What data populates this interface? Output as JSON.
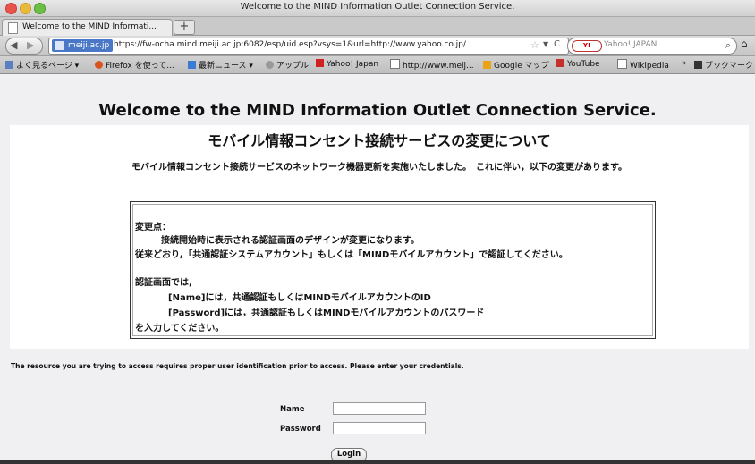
{
  "window": {
    "title": "Welcome to the MIND Information Outlet Connection Service."
  },
  "tab": {
    "label": "Welcome to the MIND Informati...",
    "new_tab": "+"
  },
  "navbar": {
    "site_identity": "meiji.ac.jp",
    "url": "https://fw-ocha.mind.meiji.ac.jp:6082/esp/uid.esp?vsys=1&url=http://www.yahoo.co.jp/",
    "search_engine": "Y!",
    "search_placeholder": "Yahoo! JAPAN"
  },
  "bookmarks": [
    {
      "label": "よく見るページ ▾",
      "icon": "bookmarks-icon"
    },
    {
      "label": "Firefox を使って...",
      "icon": "firefox-icon"
    },
    {
      "label": "最新ニュース ▾",
      "icon": "rss-icon"
    },
    {
      "label": "アップル",
      "icon": "apple-icon"
    },
    {
      "label": "Yahoo! Japan",
      "icon": "yahoo-icon"
    },
    {
      "label": "http://www.meij...",
      "icon": "page-icon"
    },
    {
      "label": "Google マップ",
      "icon": "maps-icon"
    },
    {
      "label": "YouTube",
      "icon": "youtube-icon"
    },
    {
      "label": "Wikipedia",
      "icon": "page-icon"
    },
    {
      "label": "ブックマーク",
      "icon": "bookmark-menu-icon"
    }
  ],
  "bookmarks_overflow": "»",
  "page": {
    "title_en": "Welcome to the MIND Information Outlet Connection Service.",
    "title_ja": "モバイル情報コンセント接続サービスの変更について",
    "intro": "モバイル情報コンセント接続サービスのネットワーク機器更新を実施いたしました。　これに伴い，以下の変更があります。",
    "notice": {
      "heading": "変更点：",
      "line1": "接続開始時に表示される認証画面のデザインが変更になります。",
      "line2": "従来どおり，「共通認証システムアカウント」もしくは「MINDモバイルアカウント」で認証してください。",
      "heading2": "認証画面では,",
      "line3": "[Name]には，共通認証もしくはMINDモバイルアカウントのID",
      "line4": "[Password]には，共通認証もしくはMINDモバイルアカウントのパスワード",
      "line5": "を入力してください。"
    },
    "credentials_message": "The resource you are trying to access requires proper user identification prior to access. Please enter your credentials.",
    "form": {
      "name_label": "Name",
      "password_label": "Password",
      "name_value": "",
      "password_value": "",
      "login_label": "Login"
    }
  }
}
